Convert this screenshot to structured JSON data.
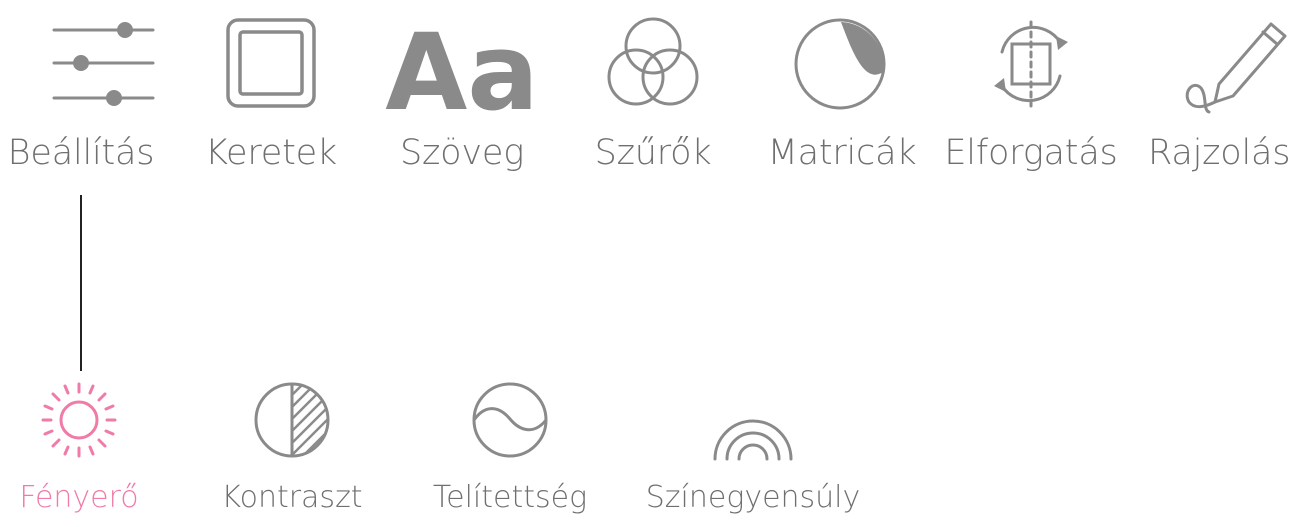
{
  "colors": {
    "icon_gray": "#8a8a8a",
    "text_gray": "#6f6f6f",
    "active_pink": "#f07aa8",
    "connector": "#222222"
  },
  "toolbar": {
    "items": [
      {
        "label": "Beállítás",
        "icon": "sliders-icon"
      },
      {
        "label": "Keretek",
        "icon": "frame-icon"
      },
      {
        "label": "Szöveg",
        "icon": "text-aa-icon"
      },
      {
        "label": "Szűrők",
        "icon": "filters-circles-icon"
      },
      {
        "label": "Matricák",
        "icon": "sticker-icon"
      },
      {
        "label": "Elforgatás",
        "icon": "rotate-icon"
      },
      {
        "label": "Rajzolás",
        "icon": "pencil-draw-icon"
      }
    ],
    "selected": "Beállítás"
  },
  "adjustments": {
    "items": [
      {
        "label": "Fényerő",
        "icon": "brightness-sun-icon"
      },
      {
        "label": "Kontraszt",
        "icon": "contrast-icon"
      },
      {
        "label": "Telítettség",
        "icon": "saturation-icon"
      },
      {
        "label": "Színegyensúly",
        "icon": "color-balance-icon"
      }
    ],
    "selected": "Fényerő"
  },
  "text_aa_glyph": "Aa"
}
